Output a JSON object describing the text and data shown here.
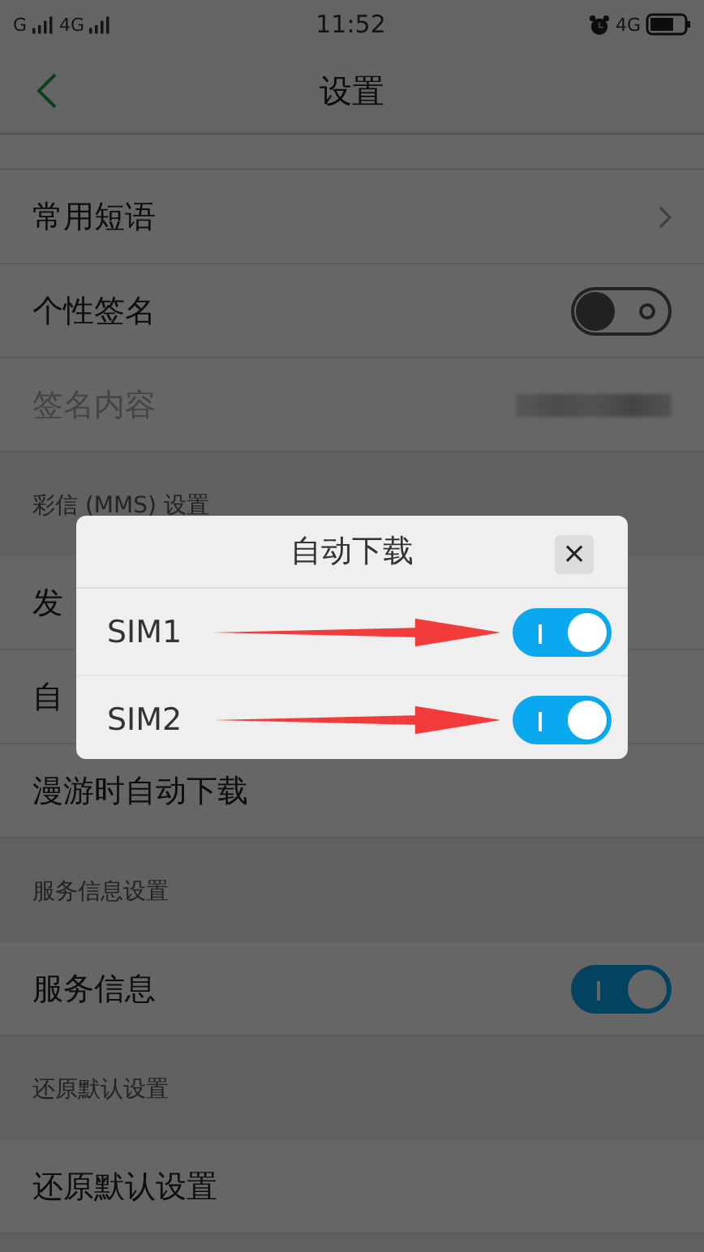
{
  "status_bar": {
    "sim1_network": "G",
    "sim2_network": "4G",
    "time": "11:52",
    "data_network": "4G"
  },
  "header": {
    "title": "设置"
  },
  "sections": [
    {
      "items": [
        {
          "kind": "link",
          "label": "常用短语"
        },
        {
          "kind": "toggle",
          "label": "个性签名",
          "on": false
        },
        {
          "kind": "value",
          "label": "签名内容",
          "disabled": true
        }
      ]
    },
    {
      "title": "彩信 (MMS) 设置",
      "items": [
        {
          "kind": "plain",
          "label": "发"
        },
        {
          "kind": "plain",
          "label": "自"
        },
        {
          "kind": "plain",
          "label": "漫游时自动下载"
        }
      ]
    },
    {
      "title": "服务信息设置",
      "items": [
        {
          "kind": "toggle",
          "label": "服务信息",
          "on": true
        }
      ]
    },
    {
      "title": "还原默认设置",
      "items": [
        {
          "kind": "plain",
          "label": "还原默认设置"
        }
      ]
    }
  ],
  "dialog": {
    "title": "自动下载",
    "close": "×",
    "rows": [
      {
        "label": "SIM1",
        "on": true,
        "marked": true
      },
      {
        "label": "SIM2",
        "on": true,
        "marked": true
      }
    ]
  }
}
